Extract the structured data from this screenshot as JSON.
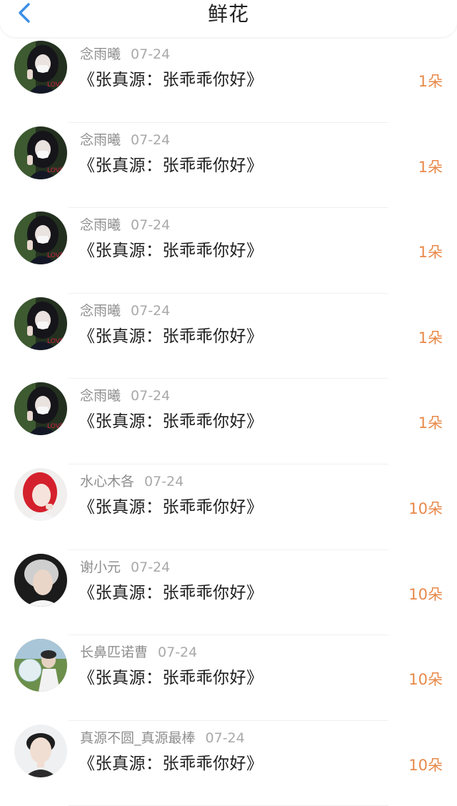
{
  "header": {
    "title": "鲜花",
    "back_icon": "chevron-left-icon",
    "accent_color": "#3a8ee6"
  },
  "gift_color": "#e8894a",
  "entries": [
    {
      "user": "念雨曦",
      "date": "07-24",
      "book": "《张真源：张乖乖你好》",
      "count": "1朵",
      "avatar": "girl-selfie-avatar"
    },
    {
      "user": "念雨曦",
      "date": "07-24",
      "book": "《张真源：张乖乖你好》",
      "count": "1朵",
      "avatar": "girl-selfie-avatar"
    },
    {
      "user": "念雨曦",
      "date": "07-24",
      "book": "《张真源：张乖乖你好》",
      "count": "1朵",
      "avatar": "girl-selfie-avatar"
    },
    {
      "user": "念雨曦",
      "date": "07-24",
      "book": "《张真源：张乖乖你好》",
      "count": "1朵",
      "avatar": "girl-selfie-avatar"
    },
    {
      "user": "念雨曦",
      "date": "07-24",
      "book": "《张真源：张乖乖你好》",
      "count": "1朵",
      "avatar": "girl-selfie-avatar"
    },
    {
      "user": "水心木各",
      "date": "07-24",
      "book": "《张真源：张乖乖你好》",
      "count": "10朵",
      "avatar": "red-hair-avatar"
    },
    {
      "user": "谢小元",
      "date": "07-24",
      "book": "《张真源：张乖乖你好》",
      "count": "10朵",
      "avatar": "silver-hair-avatar"
    },
    {
      "user": "长鼻匹诺曹",
      "date": "07-24",
      "book": "《张真源：张乖乖你好》",
      "count": "10朵",
      "avatar": "outdoor-fan-avatar"
    },
    {
      "user": "真源不圆_真源最棒",
      "date": "07-24",
      "book": "《张真源：张乖乖你好》",
      "count": "10朵",
      "avatar": "boy-portrait-avatar"
    }
  ]
}
